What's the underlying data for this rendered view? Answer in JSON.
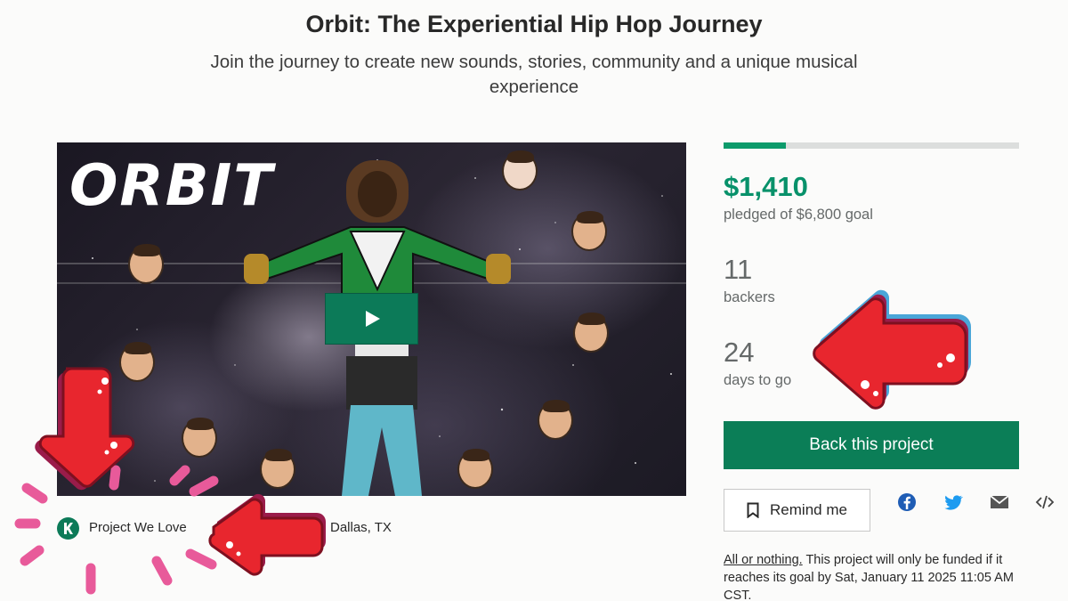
{
  "project": {
    "title": "Orbit: The Experiential Hip Hop Journey",
    "subtitle": "Join the journey to create new sounds, stories, community and a unique musical experience"
  },
  "video": {
    "logo_text": "ORBIT",
    "play_icon": "play-icon"
  },
  "meta": {
    "badge_label": "Project We Love",
    "badge_icon": "kickstarter-k-icon",
    "location": "Dallas, TX"
  },
  "stats": {
    "progress_percent": 21,
    "pledged_amount": "$1,410",
    "pledged_sub": "pledged of $6,800 goal",
    "backers_count": "11",
    "backers_label": "backers",
    "days_count": "24",
    "days_label": "days to go"
  },
  "actions": {
    "back_label": "Back this project",
    "remind_label": "Remind me",
    "remind_icon": "bookmark-icon",
    "share_icons": [
      "facebook-icon",
      "twitter-icon",
      "mail-icon",
      "embed-icon"
    ]
  },
  "funding_note": {
    "link": "All or nothing.",
    "text": " This project will only be funded if it reaches its goal by Sat, January 11 2025 11:05 AM CST."
  },
  "colors": {
    "accent_green": "#0b7e57",
    "pledged_green": "#07916a",
    "annotation_red": "#e8262e",
    "annotation_pink": "#e85a9a"
  }
}
